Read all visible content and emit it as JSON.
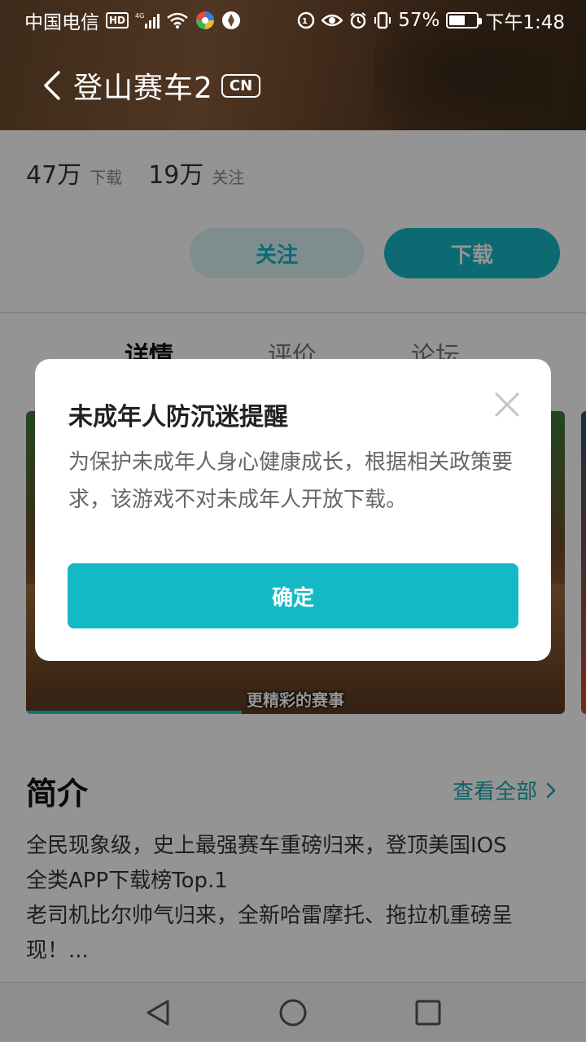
{
  "status_bar": {
    "carrier": "中国电信",
    "hd": "HD",
    "network": "4G",
    "battery_percent": "57%",
    "battery_level": 0.57,
    "time": "下午1:48"
  },
  "header": {
    "title": "登山赛车2",
    "badge": "CN"
  },
  "stats": {
    "downloads_value": "47万",
    "downloads_label": "下载",
    "followers_value": "19万",
    "followers_label": "关注"
  },
  "actions": {
    "follow_label": "关注",
    "download_label": "下载"
  },
  "tabs": [
    {
      "label": "详情",
      "active": true
    },
    {
      "label": "评价",
      "active": false
    },
    {
      "label": "论坛",
      "active": false
    }
  ],
  "media": {
    "caption": "更精彩的赛事",
    "progress": 0.4
  },
  "intro": {
    "title": "简介",
    "see_all": "查看全部",
    "line1": "全民现象级，史上最强赛车重磅归来，登顶美国IOS",
    "line2": "全类APP下载榜Top.1",
    "line3": "老司机比尔帅气归来，全新哈雷摩托、拖拉机重磅呈",
    "line4": "现！..."
  },
  "dialog": {
    "title": "未成年人防沉迷提醒",
    "body": "为保护未成年人身心健康成长，根据相关政策要求，该游戏不对未成年人开放下载。",
    "confirm_label": "确定"
  },
  "colors": {
    "accent": "#15b9c6",
    "accent_light": "#d9f3f5",
    "link": "#14aab6"
  }
}
